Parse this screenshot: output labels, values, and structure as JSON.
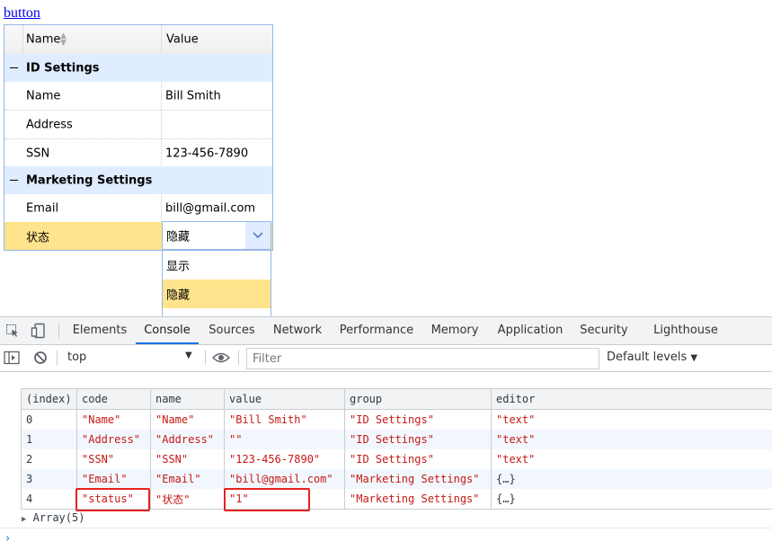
{
  "top_link": "button",
  "grid": {
    "header": {
      "name": "Name",
      "value": "Value"
    },
    "groups": [
      {
        "label": "ID Settings",
        "rows": [
          {
            "name": "Name",
            "value": "Bill Smith"
          },
          {
            "name": "Address",
            "value": ""
          },
          {
            "name": "SSN",
            "value": "123-456-7890"
          }
        ]
      },
      {
        "label": "Marketing Settings",
        "rows": [
          {
            "name": "Email",
            "value": "bill@gmail.com"
          },
          {
            "name": "状态",
            "value": "隐藏"
          }
        ]
      }
    ],
    "combo_value": "隐藏",
    "dropdown_options": [
      "显示",
      "隐藏"
    ],
    "selected_option": "隐藏"
  },
  "devtools": {
    "tabs": [
      "Elements",
      "Console",
      "Sources",
      "Network",
      "Performance",
      "Memory",
      "Application",
      "Security",
      "Lighthouse"
    ],
    "active_tab": "Console",
    "context": "top",
    "filter_placeholder": "Filter",
    "levels": "Default levels",
    "table": {
      "headers": [
        "(index)",
        "code",
        "name",
        "value",
        "group",
        "editor"
      ],
      "rows": [
        [
          "0",
          "\"Name\"",
          "\"Name\"",
          "\"Bill Smith\"",
          "\"ID Settings\"",
          "\"text\""
        ],
        [
          "1",
          "\"Address\"",
          "\"Address\"",
          "\"\"",
          "\"ID Settings\"",
          "\"text\""
        ],
        [
          "2",
          "\"SSN\"",
          "\"SSN\"",
          "\"123-456-7890\"",
          "\"ID Settings\"",
          "\"text\""
        ],
        [
          "3",
          "\"Email\"",
          "\"Email\"",
          "\"bill@gmail.com\"",
          "\"Marketing Settings\"",
          "{…}"
        ],
        [
          "4",
          "\"status\"",
          "\"状态\"",
          "\"1\"",
          "\"Marketing Settings\"",
          "{…}"
        ]
      ]
    },
    "array_summary": "Array(5)",
    "prompt": "›"
  },
  "colors": {
    "grid_border": "#95b8e7",
    "group_bg": "#e0ecff",
    "selected_bg": "#ffe48d",
    "string_red": "#c41a16",
    "highlight_box": "#e5231e",
    "active_tab_underline": "#1a73e8"
  }
}
